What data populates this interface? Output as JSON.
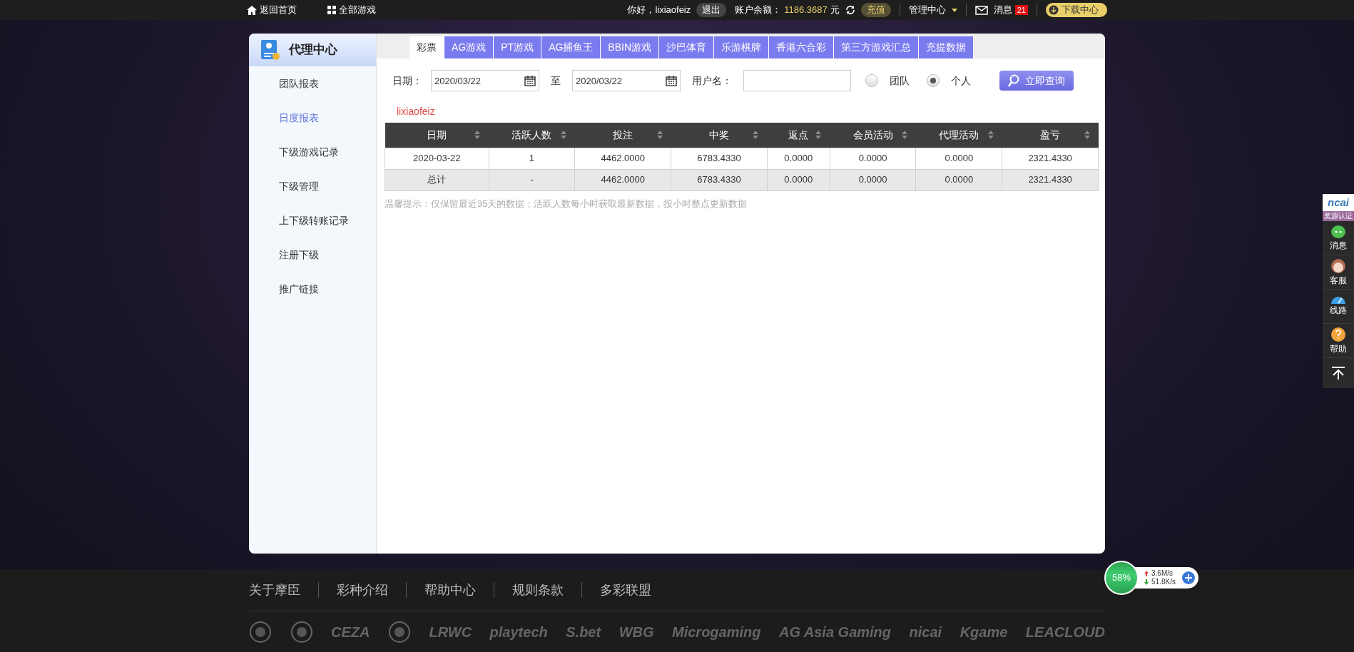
{
  "top_bar": {
    "home": "返回首页",
    "all_games": "全部游戏",
    "greeting": "你好，lixiaofeiz",
    "logout": "退出",
    "balance_label": "账户余额：",
    "balance": "1186.3687",
    "currency": "元",
    "recharge": "充值",
    "manage": "管理中心",
    "messages": "消息",
    "message_count": "21",
    "download": "下载中心"
  },
  "sidebar": {
    "title": "代理中心",
    "items": [
      {
        "label": "团队报表",
        "selected": false
      },
      {
        "label": "日度报表",
        "selected": true
      },
      {
        "label": "下级游戏记录",
        "selected": false
      },
      {
        "label": "下级管理",
        "selected": false
      },
      {
        "label": "上下级转账记录",
        "selected": false
      },
      {
        "label": "注册下级",
        "selected": false
      },
      {
        "label": "推广链接",
        "selected": false
      }
    ]
  },
  "tabs": [
    {
      "label": "彩票",
      "selected": true
    },
    {
      "label": "AG游戏",
      "selected": false
    },
    {
      "label": "PT游戏",
      "selected": false
    },
    {
      "label": "AG捕鱼王",
      "selected": false
    },
    {
      "label": "BBIN游戏",
      "selected": false
    },
    {
      "label": "沙巴体育",
      "selected": false
    },
    {
      "label": "乐游棋牌",
      "selected": false
    },
    {
      "label": "香港六合彩",
      "selected": false
    },
    {
      "label": "第三方游戏汇总",
      "selected": false
    },
    {
      "label": "充提数据",
      "selected": false
    }
  ],
  "filters": {
    "date_label": "日期：",
    "date_from": "2020/03/22",
    "to_label": "至",
    "date_to": "2020/03/22",
    "username_label": "用户名：",
    "scope": [
      {
        "label": "团队",
        "selected": false
      },
      {
        "label": "个人",
        "selected": true
      }
    ],
    "query_button": "立即查询"
  },
  "username": "lixiaofeiz",
  "table": {
    "columns": [
      "日期",
      "活跃人数",
      "投注",
      "中奖",
      "返点",
      "会员活动",
      "代理活动",
      "盈亏"
    ],
    "rows": [
      {
        "kind": "data",
        "cells": [
          "2020-03-22",
          "1",
          "4462.0000",
          "6783.4330",
          "0.0000",
          "0.0000",
          "0.0000",
          "2321.4330"
        ]
      },
      {
        "kind": "total",
        "cells": [
          "总计",
          "-",
          "4462.0000",
          "6783.4330",
          "0.0000",
          "0.0000",
          "0.0000",
          "2321.4330"
        ]
      }
    ]
  },
  "tip": "温馨提示：仅保留最近35天的数据；活跃人数每小时获取最新数据，按小时整点更新数据",
  "side_tools": {
    "badge": "奖源认证",
    "logo": "ncai",
    "items": [
      "消息",
      "客服",
      "线路",
      "帮助"
    ]
  },
  "footer": {
    "links": [
      "关于摩臣",
      "彩种介绍",
      "帮助中心",
      "规则条款",
      "多彩联盟"
    ],
    "logos": [
      {
        "kind": "emblem"
      },
      {
        "kind": "emblem"
      },
      {
        "kind": "text",
        "label": "CEZA"
      },
      {
        "kind": "emblem"
      },
      {
        "kind": "text",
        "label": "LRWC"
      },
      {
        "kind": "text",
        "label": "playtech"
      },
      {
        "kind": "text",
        "label": "S.bet"
      },
      {
        "kind": "text",
        "label": "WBG"
      },
      {
        "kind": "text",
        "label": "Microgaming"
      },
      {
        "kind": "text",
        "label": "AG Asia Gaming"
      },
      {
        "kind": "text",
        "label": "nicai"
      },
      {
        "kind": "text",
        "label": "Kgame"
      },
      {
        "kind": "text",
        "label": "LEACLOUD"
      }
    ]
  },
  "net_widget": {
    "percent": "58%",
    "up": "3.6M/s",
    "down": "51.8K/s"
  }
}
